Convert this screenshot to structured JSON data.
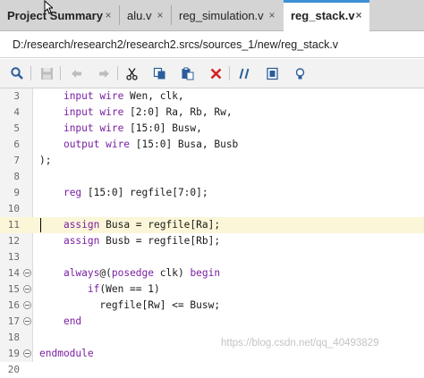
{
  "tabs": [
    {
      "label": "Project Summary",
      "close": "×",
      "active": false
    },
    {
      "label": "alu.v",
      "close": "×",
      "active": false
    },
    {
      "label": "reg_simulation.v",
      "close": "×",
      "active": false
    },
    {
      "label": "reg_stack.v",
      "close": "×",
      "active": true
    }
  ],
  "file_path": "D:/research/research2/research2.srcs/sources_1/new/reg_stack.v",
  "toolbar": [
    "search-icon",
    "save-icon",
    "undo-icon",
    "redo-icon",
    "cut-icon",
    "copy-icon",
    "paste-icon",
    "delete-icon",
    "comment-icon",
    "block-icon",
    "lightbulb-icon"
  ],
  "colors": {
    "keyword": "#7a1fa2",
    "active_tab_accent": "#3d8fd6",
    "highlight_line": "#fbf6d8",
    "delete_red": "#d42020"
  },
  "lines": [
    {
      "num": "3",
      "fold": false,
      "tokens": [
        {
          "t": "    "
        },
        {
          "t": "input wire",
          "kw": true
        },
        {
          "t": " Wen, clk,"
        }
      ]
    },
    {
      "num": "4",
      "fold": false,
      "tokens": [
        {
          "t": "    "
        },
        {
          "t": "input wire",
          "kw": true
        },
        {
          "t": " [2:0] Ra, Rb, Rw,"
        }
      ]
    },
    {
      "num": "5",
      "fold": false,
      "tokens": [
        {
          "t": "    "
        },
        {
          "t": "input wire",
          "kw": true
        },
        {
          "t": " [15:0] Busw,"
        }
      ]
    },
    {
      "num": "6",
      "fold": false,
      "tokens": [
        {
          "t": "    "
        },
        {
          "t": "output wire",
          "kw": true
        },
        {
          "t": " [15:0] Busa, Busb"
        }
      ]
    },
    {
      "num": "7",
      "fold": false,
      "tokens": [
        {
          "t": ");"
        }
      ]
    },
    {
      "num": "8",
      "fold": false,
      "tokens": []
    },
    {
      "num": "9",
      "fold": false,
      "tokens": [
        {
          "t": "    "
        },
        {
          "t": "reg",
          "kw": true
        },
        {
          "t": " [15:0] regfile[7:0];"
        }
      ]
    },
    {
      "num": "10",
      "fold": false,
      "tokens": []
    },
    {
      "num": "11",
      "fold": false,
      "highlight": true,
      "tokens": [
        {
          "t": "    "
        },
        {
          "t": "assign",
          "kw": true
        },
        {
          "t": " Busa = regfile[Ra];"
        }
      ]
    },
    {
      "num": "12",
      "fold": false,
      "tokens": [
        {
          "t": "    "
        },
        {
          "t": "assign",
          "kw": true
        },
        {
          "t": " Busb = regfile[Rb];"
        }
      ]
    },
    {
      "num": "13",
      "fold": false,
      "tokens": []
    },
    {
      "num": "14",
      "fold": true,
      "tokens": [
        {
          "t": "    "
        },
        {
          "t": "always",
          "kw": true
        },
        {
          "t": "@("
        },
        {
          "t": "posedge",
          "kw": true
        },
        {
          "t": " clk) "
        },
        {
          "t": "begin",
          "kw": true
        }
      ]
    },
    {
      "num": "15",
      "fold": true,
      "tokens": [
        {
          "t": "        "
        },
        {
          "t": "if",
          "kw": true
        },
        {
          "t": "(Wen == 1)"
        }
      ]
    },
    {
      "num": "16",
      "fold": true,
      "tokens": [
        {
          "t": "          regfile[Rw] <= Busw;"
        }
      ]
    },
    {
      "num": "17",
      "fold": true,
      "tokens": [
        {
          "t": "    "
        },
        {
          "t": "end",
          "kw": true
        }
      ]
    },
    {
      "num": "18",
      "fold": false,
      "tokens": []
    },
    {
      "num": "19",
      "fold": true,
      "tokens": [
        {
          "t": "endmodule",
          "kw": true
        }
      ]
    },
    {
      "num": "20",
      "fold": false,
      "tokens": []
    }
  ],
  "watermark": "https://blog.csdn.net/qq_40493829"
}
